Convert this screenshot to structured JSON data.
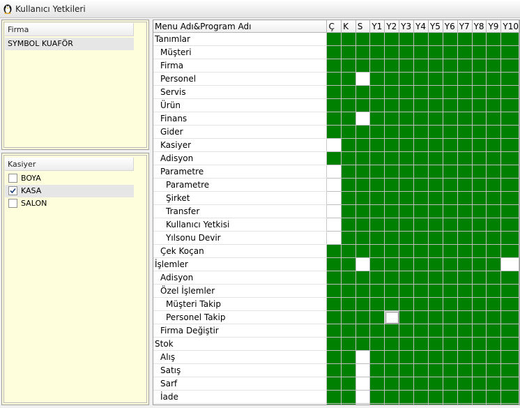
{
  "window": {
    "title": "Kullanıcı Yetkileri"
  },
  "firma_panel": {
    "header": "Firma",
    "items": [
      {
        "label": "SYMBOL KUAFÖR",
        "selected": true
      }
    ]
  },
  "kasiyer_panel": {
    "header": "Kasiyer",
    "items": [
      {
        "label": "BOYA",
        "checked": false,
        "selected": false
      },
      {
        "label": "KASA",
        "checked": true,
        "selected": true
      },
      {
        "label": "SALON",
        "checked": false,
        "selected": false
      }
    ]
  },
  "grid": {
    "name_header": "Menu Adı&Program Adı",
    "columns": [
      "Ç",
      "K",
      "S",
      "Y1",
      "Y2",
      "Y3",
      "Y4",
      "Y5",
      "Y6",
      "Y7",
      "Y8",
      "Y9",
      "Y10"
    ],
    "colors": {
      "granted": "#008000",
      "denied": "#ffffff"
    },
    "rows": [
      {
        "label": "Tanımlar",
        "level": 0,
        "perms": [
          1,
          1,
          1,
          1,
          1,
          1,
          1,
          1,
          1,
          1,
          1,
          1,
          1
        ]
      },
      {
        "label": "Müşteri",
        "level": 1,
        "perms": [
          1,
          1,
          1,
          1,
          1,
          1,
          1,
          1,
          1,
          1,
          1,
          1,
          1
        ]
      },
      {
        "label": "Firma",
        "level": 1,
        "perms": [
          1,
          1,
          1,
          1,
          1,
          1,
          1,
          1,
          1,
          1,
          1,
          1,
          1
        ]
      },
      {
        "label": "Personel",
        "level": 1,
        "perms": [
          1,
          1,
          0,
          1,
          1,
          1,
          1,
          1,
          1,
          1,
          1,
          1,
          1
        ]
      },
      {
        "label": "Servis",
        "level": 1,
        "perms": [
          1,
          1,
          1,
          1,
          1,
          1,
          1,
          1,
          1,
          1,
          1,
          1,
          1
        ]
      },
      {
        "label": "Ürün",
        "level": 1,
        "perms": [
          1,
          1,
          1,
          1,
          1,
          1,
          1,
          1,
          1,
          1,
          1,
          1,
          1
        ]
      },
      {
        "label": "Finans",
        "level": 1,
        "perms": [
          1,
          1,
          0,
          1,
          1,
          1,
          1,
          1,
          1,
          1,
          1,
          1,
          1
        ]
      },
      {
        "label": "Gider",
        "level": 1,
        "perms": [
          1,
          1,
          1,
          1,
          1,
          1,
          1,
          1,
          1,
          1,
          1,
          1,
          1
        ]
      },
      {
        "label": "Kasiyer",
        "level": 1,
        "perms": [
          0,
          1,
          1,
          1,
          1,
          1,
          1,
          1,
          1,
          1,
          1,
          1,
          1
        ]
      },
      {
        "label": "Adisyon",
        "level": 1,
        "perms": [
          1,
          1,
          1,
          1,
          1,
          1,
          1,
          1,
          1,
          1,
          1,
          1,
          1
        ]
      },
      {
        "label": "Parametre",
        "level": 1,
        "perms": [
          0,
          1,
          1,
          1,
          1,
          1,
          1,
          1,
          1,
          1,
          1,
          1,
          1
        ]
      },
      {
        "label": "Parametre",
        "level": 2,
        "perms": [
          0,
          1,
          1,
          1,
          1,
          1,
          1,
          1,
          1,
          1,
          1,
          1,
          1
        ]
      },
      {
        "label": "Şirket",
        "level": 2,
        "perms": [
          0,
          1,
          1,
          1,
          1,
          1,
          1,
          1,
          1,
          1,
          1,
          1,
          1
        ]
      },
      {
        "label": "Transfer",
        "level": 2,
        "perms": [
          0,
          1,
          1,
          1,
          1,
          1,
          1,
          1,
          1,
          1,
          1,
          1,
          1
        ]
      },
      {
        "label": "Kullanıcı Yetkisi",
        "level": 2,
        "perms": [
          0,
          1,
          1,
          1,
          1,
          1,
          1,
          1,
          1,
          1,
          1,
          1,
          1
        ]
      },
      {
        "label": "Yılsonu Devir",
        "level": 2,
        "perms": [
          0,
          1,
          1,
          1,
          1,
          1,
          1,
          1,
          1,
          1,
          1,
          1,
          1
        ]
      },
      {
        "label": "Çek Koçan",
        "level": 1,
        "perms": [
          1,
          1,
          1,
          1,
          1,
          1,
          1,
          1,
          1,
          1,
          1,
          1,
          1
        ]
      },
      {
        "label": "İşlemler",
        "level": 0,
        "perms": [
          1,
          1,
          0,
          1,
          1,
          1,
          1,
          1,
          1,
          1,
          1,
          1,
          0
        ]
      },
      {
        "label": "Adisyon",
        "level": 1,
        "perms": [
          1,
          1,
          1,
          1,
          1,
          1,
          1,
          1,
          1,
          1,
          1,
          1,
          1
        ]
      },
      {
        "label": "Özel İşlemler",
        "level": 1,
        "perms": [
          1,
          1,
          1,
          1,
          1,
          1,
          1,
          1,
          1,
          1,
          1,
          1,
          1
        ]
      },
      {
        "label": "Müşteri Takip",
        "level": 2,
        "perms": [
          1,
          1,
          1,
          1,
          1,
          1,
          1,
          1,
          1,
          1,
          1,
          1,
          1
        ]
      },
      {
        "label": "Personel Takip",
        "level": 2,
        "perms": [
          1,
          1,
          1,
          1,
          0,
          1,
          1,
          1,
          1,
          1,
          1,
          1,
          1
        ]
      },
      {
        "label": "Firma Değiştir",
        "level": 1,
        "perms": [
          1,
          1,
          1,
          1,
          1,
          1,
          1,
          1,
          1,
          1,
          1,
          1,
          1
        ]
      },
      {
        "label": "Stok",
        "level": 0,
        "perms": [
          1,
          1,
          1,
          1,
          1,
          1,
          1,
          1,
          1,
          1,
          1,
          1,
          1
        ]
      },
      {
        "label": "Alış",
        "level": 1,
        "perms": [
          1,
          1,
          0,
          1,
          1,
          1,
          1,
          1,
          1,
          1,
          1,
          1,
          1
        ]
      },
      {
        "label": "Satış",
        "level": 1,
        "perms": [
          1,
          1,
          0,
          1,
          1,
          1,
          1,
          1,
          1,
          1,
          1,
          1,
          1
        ]
      },
      {
        "label": "Sarf",
        "level": 1,
        "perms": [
          1,
          1,
          0,
          1,
          1,
          1,
          1,
          1,
          1,
          1,
          1,
          1,
          1
        ]
      },
      {
        "label": "İade",
        "level": 1,
        "perms": [
          1,
          1,
          0,
          1,
          1,
          1,
          1,
          1,
          1,
          1,
          1,
          1,
          1
        ]
      },
      {
        "label": "",
        "level": 1,
        "perms": [
          1,
          1,
          0,
          1,
          1,
          1,
          1,
          1,
          1,
          1,
          1,
          1,
          1
        ]
      }
    ]
  }
}
